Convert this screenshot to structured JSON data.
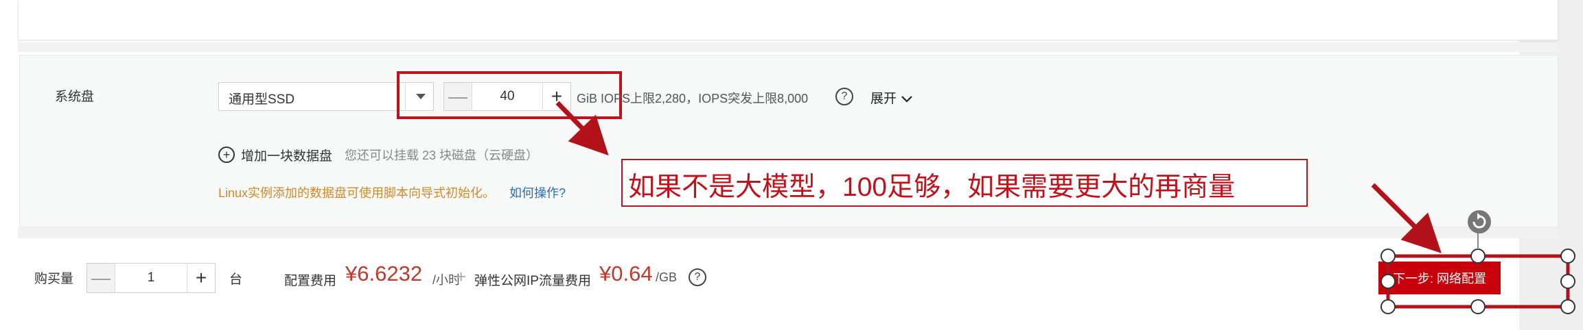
{
  "system_disk": {
    "label": "系统盘",
    "type_value": "通用型SSD",
    "size_value": "40",
    "minus": "—",
    "plus": "+",
    "iops_text": "GiB IOPS上限2,280，IOPS突发上限8,000",
    "help": "?",
    "expand_label": "展开"
  },
  "data_disk": {
    "add_icon": "+",
    "add_label": "增加一块数据盘",
    "hint": "您还可以挂载 23 块磁盘（云硬盘）",
    "linux_note": "Linux实例添加的数据盘可使用脚本向导式初始化。",
    "how_link": "如何操作?"
  },
  "annotation": {
    "text": "如果不是大模型，100足够，如果需要更大的再商量",
    "color": "#c0121b"
  },
  "footer": {
    "qty_label": "购买量",
    "qty_value": "1",
    "qty_minus": "—",
    "qty_plus": "+",
    "qty_unit": "台",
    "fee_label": "配置费用",
    "fee_value": "¥6.6232",
    "fee_unit": "/小时",
    "plus_sep": "+",
    "ip_label": "弹性公网IP流量费用",
    "ip_value": "¥0.64",
    "ip_unit": "/GB",
    "help": "?",
    "next_button": "下一步: 网络配置"
  },
  "colors": {
    "brand_red": "#c7000b",
    "price_red": "#c0392b",
    "link_blue": "#2b6cbf",
    "note_orange": "#d08a2a"
  }
}
